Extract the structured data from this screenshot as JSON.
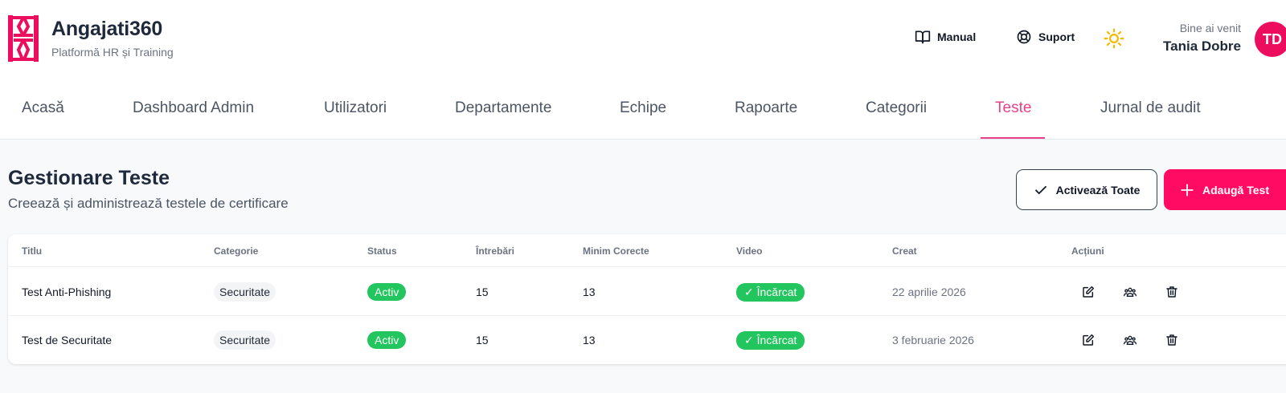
{
  "header": {
    "brand_title": "Angajati360",
    "brand_subtitle": "Platformă HR și Training",
    "manual_label": "Manual",
    "support_label": "Suport",
    "welcome_label": "Bine ai venit",
    "user_name": "Tania Dobre",
    "avatar_initials": "TD"
  },
  "nav": {
    "items": [
      "Acasă",
      "Dashboard Admin",
      "Utilizatori",
      "Departamente",
      "Echipe",
      "Rapoarte",
      "Categorii",
      "Teste",
      "Jurnal de audit"
    ],
    "active": "Teste"
  },
  "page": {
    "title": "Gestionare Teste",
    "subtitle": "Creează și administrează testele de certificare",
    "activate_all_label": "Activează Toate",
    "add_test_label": "Adaugă Test"
  },
  "table": {
    "columns": [
      "Titlu",
      "Categorie",
      "Status",
      "Întrebări",
      "Minim Corecte",
      "Video",
      "Creat",
      "Acțiuni"
    ],
    "rows": [
      {
        "title": "Test Anti-Phishing",
        "category": "Securitate",
        "status": "Activ",
        "questions": "15",
        "min_correct": "13",
        "video": "✓ Încărcat",
        "created": "22 aprilie 2026"
      },
      {
        "title": "Test de Securitate",
        "category": "Securitate",
        "status": "Activ",
        "questions": "15",
        "min_correct": "13",
        "video": "✓ Încărcat",
        "created": "3 februarie 2026"
      }
    ]
  },
  "colors": {
    "brand": "#ec0d5f",
    "accent_nav": "#e8408a",
    "success": "#22c55e",
    "theme_icon": "#f5b800"
  },
  "icons": {
    "logo": "angajati360-logo",
    "manual": "book-open-icon",
    "support": "lifebuoy-icon",
    "theme": "sun-icon",
    "activate": "check-icon",
    "add": "plus-icon",
    "edit": "edit-icon",
    "assign": "users-icon",
    "delete": "trash-icon"
  }
}
